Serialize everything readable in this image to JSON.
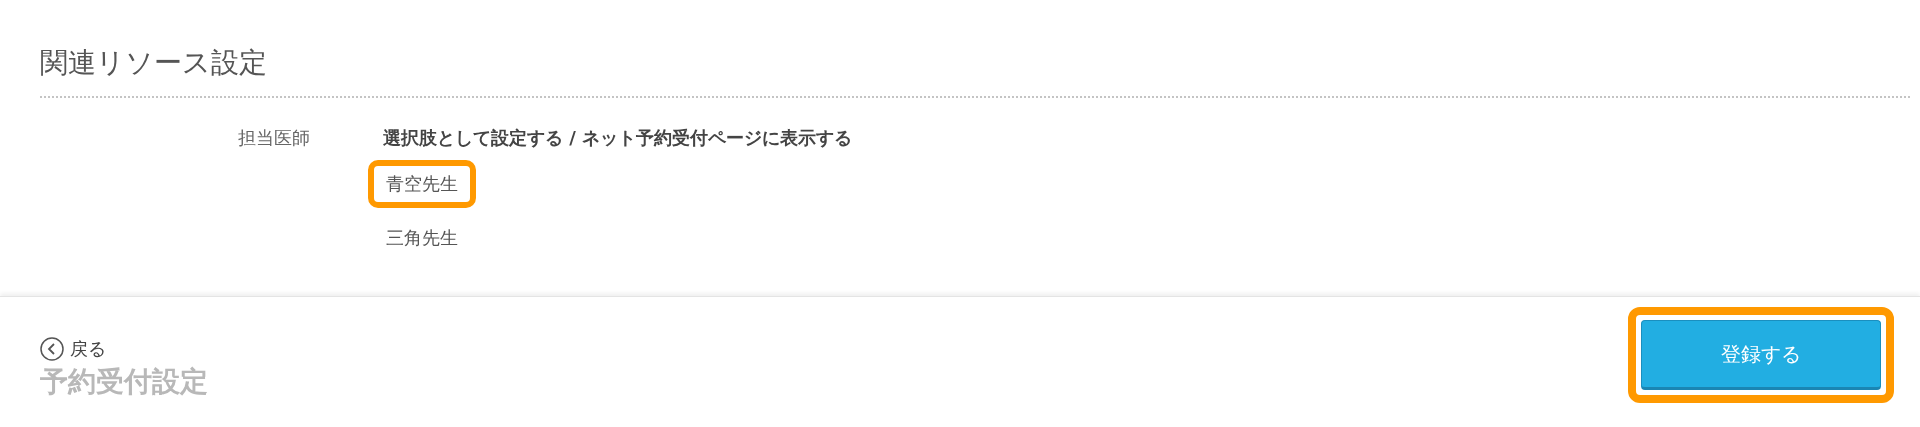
{
  "section": {
    "title": "関連リソース設定"
  },
  "doctor_setting": {
    "label": "担当医師",
    "header": "選択肢として設定する / ネット予約受付ページに表示する",
    "doctors": [
      {
        "name": "青空先生",
        "highlighted": true
      },
      {
        "name": "三角先生",
        "highlighted": false
      }
    ]
  },
  "footer": {
    "back_link": "戻る",
    "page_title": "予約受付設定",
    "submit_button": {
      "label": "登録する",
      "highlighted": true
    }
  }
}
